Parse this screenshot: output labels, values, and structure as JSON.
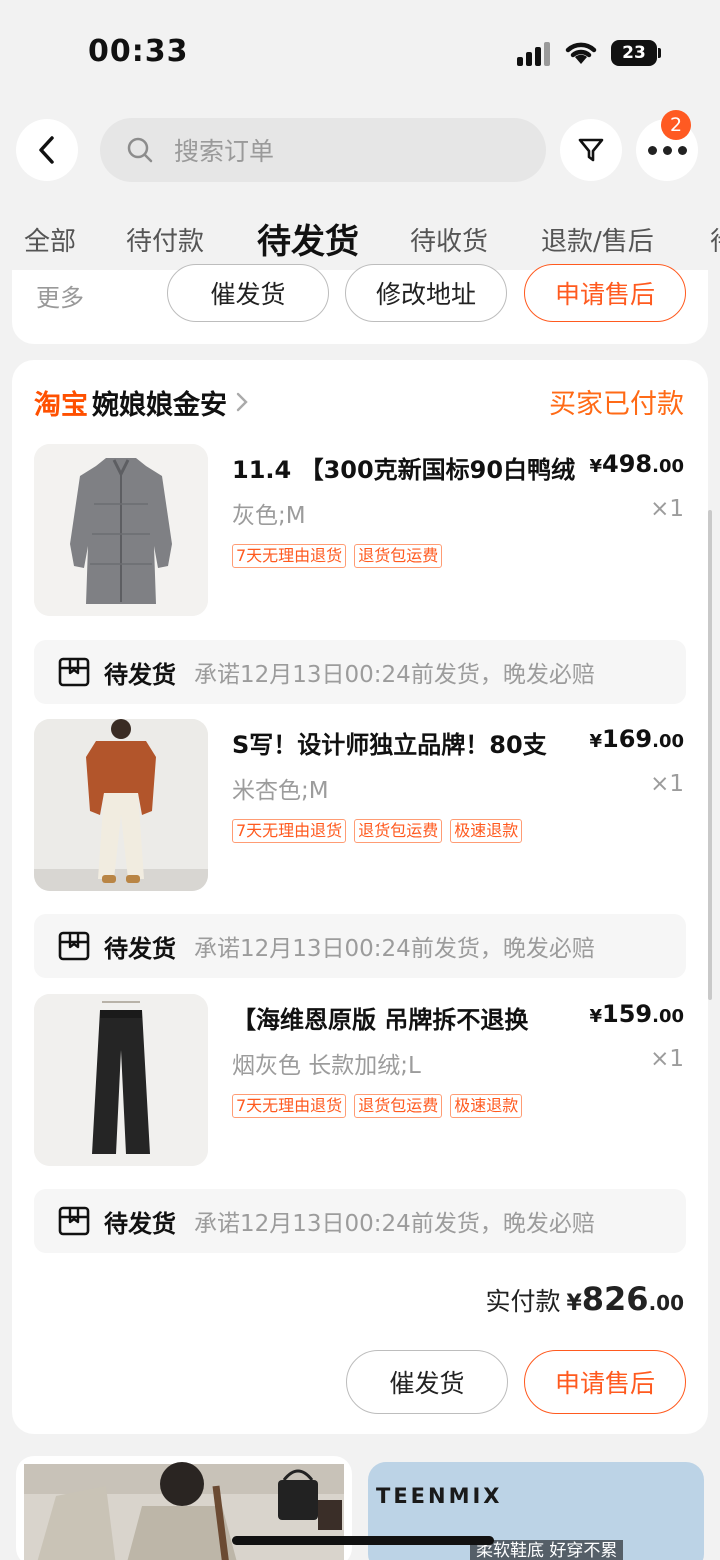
{
  "status_bar": {
    "time": "00:33",
    "battery": "23"
  },
  "header": {
    "search_placeholder": "搜索订单",
    "notification_count": "2"
  },
  "tabs": [
    {
      "label": "全部"
    },
    {
      "label": "待付款"
    },
    {
      "label": "待发货"
    },
    {
      "label": "待收货"
    },
    {
      "label": "退款/售后"
    },
    {
      "label": "待"
    }
  ],
  "prev_order": {
    "more": "更多",
    "btn_urge": "催发货",
    "btn_address": "修改地址",
    "btn_aftersale": "申请售后"
  },
  "order": {
    "platform": "淘宝",
    "shop_name": "婉娘娘金安",
    "status": "买家已付款",
    "items": [
      {
        "title": "11.4 【300克新国标90白鸭绒",
        "price_symbol": "¥",
        "price_int": "498",
        "price_dec": ".00",
        "spec": "灰色;M",
        "qty": "×1",
        "tags": [
          "7天无理由退货",
          "退货包运费"
        ],
        "ship_status": "待发货",
        "ship_promise": "承诺12月13日00:24前发货，晚发必赔"
      },
      {
        "title": "S写！设计师独立品牌！80支",
        "price_symbol": "¥",
        "price_int": "169",
        "price_dec": ".00",
        "spec": "米杏色;M",
        "qty": "×1",
        "tags": [
          "7天无理由退货",
          "退货包运费",
          "极速退款"
        ],
        "ship_status": "待发货",
        "ship_promise": "承诺12月13日00:24前发货，晚发必赔"
      },
      {
        "title": "【海维恩原版 吊牌拆不退换",
        "price_symbol": "¥",
        "price_int": "159",
        "price_dec": ".00",
        "spec": "烟灰色 长款加绒;L",
        "qty": "×1",
        "tags": [
          "7天无理由退货",
          "退货包运费",
          "极速退款"
        ],
        "ship_status": "待发货",
        "ship_promise": "承诺12月13日00:24前发货，晚发必赔"
      }
    ],
    "total_label": "实付款",
    "total_symbol": "¥",
    "total_int": "826",
    "total_dec": ".00",
    "btn_urge": "催发货",
    "btn_aftersale": "申请售后"
  },
  "recommend": {
    "right_brand": "TEENMIX",
    "right_caption": "柔软鞋底 好穿不累"
  }
}
